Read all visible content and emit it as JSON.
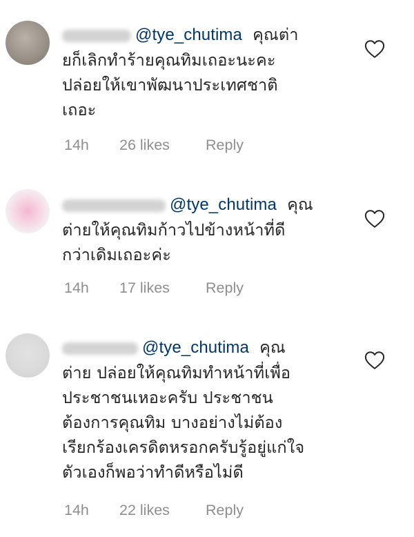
{
  "comments": [
    {
      "mention": "@tye_chutima",
      "lines": [
        "คุณต่า",
        "ยก็เลิกทำร้ายคุณทิมเถอะนะคะ",
        "ปล่อยให้เขาพัฒนาประเทศชาติ",
        "เถอะ"
      ],
      "time": "14h",
      "likes": "26 likes",
      "reply_label": "Reply",
      "like_icon": "heart-outline-icon"
    },
    {
      "mention": "@tye_chutima",
      "lines": [
        "คุณ",
        "ต่ายให้คุณทิมก้าวไปข้างหน้าที่ดี",
        "กว่าเดิมเถอะค่ะ"
      ],
      "time": "14h",
      "likes": "17 likes",
      "reply_label": "Reply",
      "like_icon": "heart-outline-icon"
    },
    {
      "mention": "@tye_chutima",
      "lines": [
        "คุณ",
        "ต่าย  ปล่อยให้คุณทิมทำหน้าที่เพื่อ",
        "ประชาชนเหอะครับ  ประชาชน",
        "ต้องการคุณทิม  บางอย่างไม่ต้อง",
        "เรียกร้องเครดิตหรอกครับรู้อยู่แก่ใจ",
        "ตัวเองก็พอว่าทำดีหรือไม่ดี"
      ],
      "time": "14h",
      "likes": "22 likes",
      "reply_label": "Reply",
      "like_icon": "heart-outline-icon"
    }
  ]
}
